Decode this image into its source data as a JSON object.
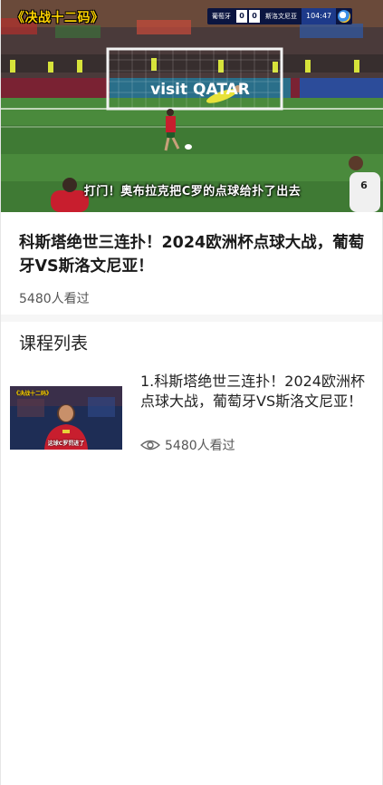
{
  "video": {
    "series_tag": "《决战十二码》",
    "scoreboard": {
      "home_team": "葡萄牙",
      "home_score": "0",
      "away_score": "0",
      "away_team": "斯洛文尼亚",
      "clock": "104:47"
    },
    "ad_board_text": "visit QATAR",
    "subtitle": "打门！奥布拉克把C罗的点球给扑了出去",
    "player_number": "6"
  },
  "detail": {
    "title": "科斯塔绝世三连扑！2024欧洲杯点球大战，葡萄牙VS斯洛文尼亚！",
    "views": "5480人看过"
  },
  "course_list": {
    "heading": "课程列表",
    "items": [
      {
        "title": "1.科斯塔绝世三连扑！2024欧洲杯点球大战，葡萄牙VS斯洛文尼亚！",
        "views": "5480人看过",
        "thumb_tag": "《决战十二码》",
        "thumb_subtitle": "这球C罗罚进了"
      }
    ]
  },
  "colors": {
    "accent_yellow": "#ffd400",
    "pitch_green": "#3f7a34",
    "text_primary": "#1a1a1a",
    "text_secondary": "#555555"
  }
}
